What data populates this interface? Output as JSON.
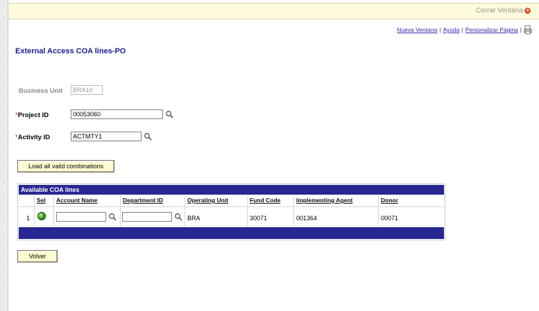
{
  "window": {
    "close_label": "Cerrar Ventana"
  },
  "header_links": [
    {
      "label": "Nueva Ventana"
    },
    {
      "label": "Ayuda"
    },
    {
      "label": "Personalizar Página"
    }
  ],
  "page": {
    "title": "External Access COA lines-PO"
  },
  "form": {
    "business_unit": {
      "label": "Business Unit",
      "value": "BRA10"
    },
    "project_id": {
      "label": "Project ID",
      "required_mark": "*",
      "value": "00053060"
    },
    "activity_id": {
      "label": "Activity ID",
      "required_mark": "*",
      "value": "ACTMTY1"
    },
    "load_button": "Load all valid combinations"
  },
  "grid": {
    "title": "Available COA lines",
    "columns": [
      "Sel",
      "Account Name",
      "Department ID",
      "Operating Unit",
      "Fund Code",
      "Implementing Agent",
      "Donor"
    ],
    "rows": [
      {
        "row_number": "1",
        "selected_status": "green",
        "account_name": "",
        "department_id": "",
        "operating_unit": "BRA",
        "fund_code": "30071",
        "implementing_agent": "001364",
        "donor": "00071"
      }
    ]
  },
  "actions": {
    "return_button": "Volver"
  },
  "colors": {
    "brand_navy": "#272791",
    "title_blue": "#1b1b96",
    "link_blue": "#2b2ba8",
    "button_bg": "#fffdd0",
    "topbar_bg": "#fdfbdc"
  },
  "icons": {
    "close": "close-icon",
    "lookup": "search-icon",
    "print": "print-icon",
    "status": "status-dot-icon"
  }
}
